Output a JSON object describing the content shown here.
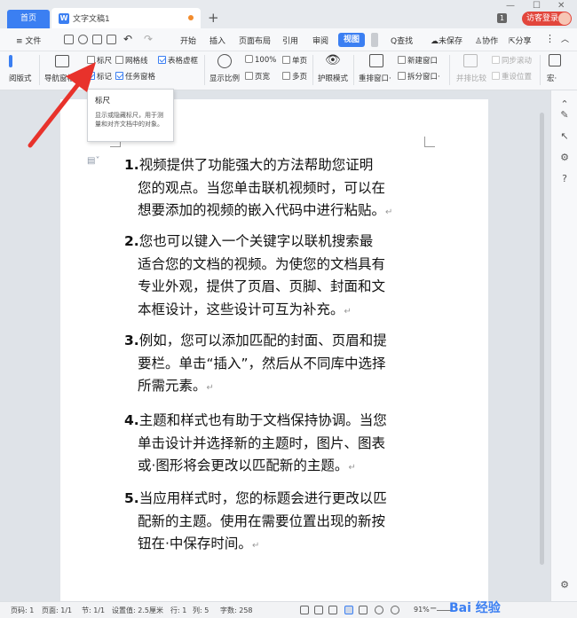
{
  "titlebar": {
    "home_tab": "首页",
    "doc_tab": "文字文稿1",
    "doc_icon_letter": "W",
    "new_tab": "+",
    "badge": "1",
    "login": "访客登录"
  },
  "menubar": {
    "file": "≡ 文件",
    "tabs": [
      "开始",
      "插入",
      "页面布局",
      "引用",
      "审阅",
      "视图"
    ],
    "find": "Q查找",
    "unsaved": "未保存",
    "collab": "协作",
    "share": "分享"
  },
  "ribbon": {
    "readmode": "阅版式",
    "navpane": "导航窗格",
    "ruler": "标尺",
    "gridlines": "网格线",
    "table_gridlines": "表格虚框",
    "marks": "标记",
    "taskpane": "任务窗格",
    "show_ratio": "显示比例",
    "zoom100": "100%",
    "page_width": "页宽",
    "single_page": "单页",
    "multi_page": "多页",
    "eye_mode": "护眼模式",
    "arrange": "重排窗口·",
    "new_window": "新建窗口",
    "split_window": "拆分窗口·",
    "side_by_side": "并排比较",
    "sync_scroll": "同步滚动",
    "reset_pos": "重设位置",
    "macro": "宏·"
  },
  "tooltip": {
    "title": "标尺",
    "body": "显示或隐藏标尺，用于测量和对齐文档中的对象。"
  },
  "document": {
    "paragraphs": [
      {
        "num": "1.",
        "lines": [
          "视频提供了功能强大的方法帮助您证明",
          "您的观点。当您单击联机视频时，可以在",
          "想要添加的视频的嵌入代码中进行粘贴。"
        ]
      },
      {
        "num": "2.",
        "lines": [
          "您也可以键入一个关键字以联机搜索最",
          "适合您的文档的视频。为使您的文档具有",
          "专业外观，提供了页眉、页脚、封面和文",
          "本框设计，这些设计可互为补充。"
        ]
      },
      {
        "num": "3.",
        "lines": [
          "例如，您可以添加匹配的封面、页眉和提",
          "要栏。单击“插入”，然后从不同库中选择",
          "所需元素。"
        ]
      },
      {
        "num": "4.",
        "lines": [
          "主题和样式也有助于文档保持协调。当您",
          "单击设计并选择新的主题时，图片、图表",
          "或·图形将会更改以匹配新的主题。"
        ]
      },
      {
        "num": "5.",
        "lines": [
          "当应用样式时，您的标题会进行更改以匹",
          "配新的主题。使用在需要位置出现的新按",
          "钮在·中保存时间。"
        ]
      }
    ],
    "return_mark": "↵"
  },
  "statusbar": {
    "page_no": "页码: 1",
    "page": "页面: 1/1",
    "section": "节: 1/1",
    "setting": "设置值: 2.5厘米",
    "row": "行: 1",
    "col": "列: 5",
    "words": "字数: 258",
    "zoom": "91%"
  },
  "watermark": "Bai 经验",
  "colors": {
    "accent": "#3b7ff2",
    "login": "#e2463c",
    "arrow": "#e8322b"
  }
}
